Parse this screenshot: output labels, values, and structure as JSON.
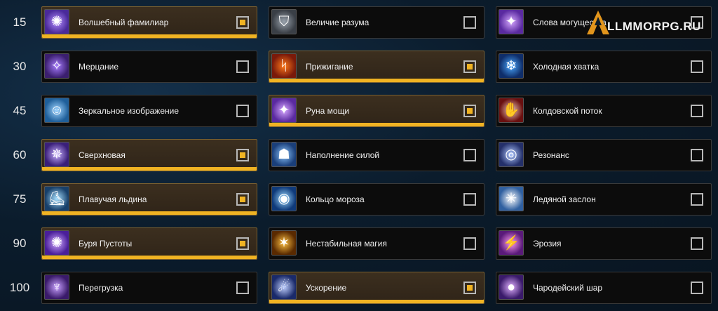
{
  "levels": [
    "15",
    "30",
    "45",
    "60",
    "75",
    "90",
    "100"
  ],
  "colors": {
    "accent": "#f0b323",
    "selected_bg": "#3c2f1f",
    "row_bg": "#0c0c0c"
  },
  "watermark": {
    "brand": "LLMMORPG.RU"
  },
  "rows": [
    {
      "talents": [
        {
          "name": "Волшебный фамилиар",
          "icon": "arcane-familiar-icon",
          "selected": true
        },
        {
          "name": "Величие разума",
          "icon": "helmet-icon",
          "selected": false
        },
        {
          "name": "Слова могущества",
          "icon": "rune-of-power-icon",
          "selected": false
        }
      ]
    },
    {
      "talents": [
        {
          "name": "Мерцание",
          "icon": "shimmer-icon",
          "selected": false
        },
        {
          "name": "Прижигание",
          "icon": "cauterize-icon",
          "selected": true
        },
        {
          "name": "Холодная хватка",
          "icon": "cold-snap-icon",
          "selected": false
        }
      ]
    },
    {
      "talents": [
        {
          "name": "Зеркальное изображение",
          "icon": "mirror-image-icon",
          "selected": false
        },
        {
          "name": "Руна мощи",
          "icon": "rune-of-power-icon",
          "selected": true
        },
        {
          "name": "Колдовской поток",
          "icon": "incanters-flow-icon",
          "selected": false
        }
      ]
    },
    {
      "talents": [
        {
          "name": "Сверхновая",
          "icon": "supernova-icon",
          "selected": true
        },
        {
          "name": "Наполнение силой",
          "icon": "charged-up-icon",
          "selected": false
        },
        {
          "name": "Резонанс",
          "icon": "resonance-icon",
          "selected": false
        }
      ]
    },
    {
      "talents": [
        {
          "name": "Плавучая льдина",
          "icon": "ice-floes-icon",
          "selected": true
        },
        {
          "name": "Кольцо мороза",
          "icon": "ring-of-frost-icon",
          "selected": false
        },
        {
          "name": "Ледяной заслон",
          "icon": "ice-ward-icon",
          "selected": false
        }
      ]
    },
    {
      "talents": [
        {
          "name": "Буря Пустоты",
          "icon": "nether-tempest-icon",
          "selected": true
        },
        {
          "name": "Нестабильная магия",
          "icon": "unstable-magic-icon",
          "selected": false
        },
        {
          "name": "Эрозия",
          "icon": "erosion-icon",
          "selected": false
        }
      ]
    },
    {
      "talents": [
        {
          "name": "Перегрузка",
          "icon": "overpowered-icon",
          "selected": false
        },
        {
          "name": "Ускорение",
          "icon": "time-anomaly-icon",
          "selected": true
        },
        {
          "name": "Чародейский шар",
          "icon": "arcane-orb-icon",
          "selected": false
        }
      ]
    }
  ]
}
